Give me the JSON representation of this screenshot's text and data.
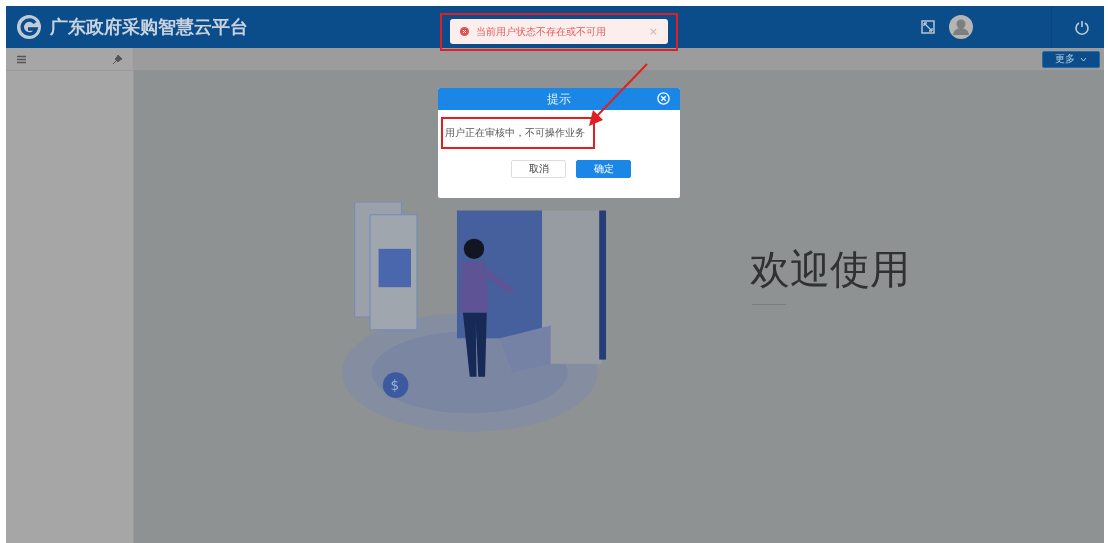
{
  "header": {
    "title": "广东政府采购智慧云平台"
  },
  "toolbar": {
    "more_button": "更多"
  },
  "welcome": {
    "text": "欢迎使用"
  },
  "illustration": {
    "coin_symbol": "$"
  },
  "toast": {
    "message": "当前用户状态不存在或不可用",
    "close": "×"
  },
  "dialog": {
    "title": "提示",
    "message": "用户正在审核中，不可操作业务",
    "buttons": [
      {
        "label": "取消",
        "kind": "secondary"
      },
      {
        "label": "确定",
        "kind": "primary"
      }
    ]
  }
}
